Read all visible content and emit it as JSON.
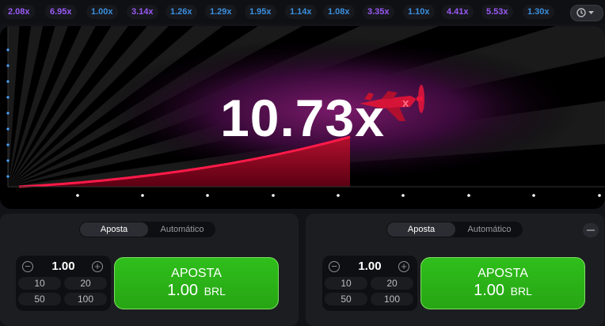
{
  "history": [
    {
      "value": "2.08x",
      "color": "#9b59f5"
    },
    {
      "value": "6.95x",
      "color": "#9b59f5"
    },
    {
      "value": "1.00x",
      "color": "#3a8fde"
    },
    {
      "value": "3.14x",
      "color": "#9b59f5"
    },
    {
      "value": "1.26x",
      "color": "#3a8fde"
    },
    {
      "value": "1.29x",
      "color": "#3a8fde"
    },
    {
      "value": "1.95x",
      "color": "#3a8fde"
    },
    {
      "value": "1.14x",
      "color": "#3a8fde"
    },
    {
      "value": "1.08x",
      "color": "#3a8fde"
    },
    {
      "value": "3.35x",
      "color": "#9b59f5"
    },
    {
      "value": "1.10x",
      "color": "#3a8fde"
    },
    {
      "value": "4.41x",
      "color": "#9b59f5"
    },
    {
      "value": "5.53x",
      "color": "#9b59f5"
    },
    {
      "value": "1.30x",
      "color": "#3a8fde"
    }
  ],
  "history_button": {
    "icons": [
      "history-icon",
      "chevron-down-icon"
    ]
  },
  "game": {
    "multiplier": "10.73x",
    "accent": "#e8153c"
  },
  "panels": [
    {
      "tabs": {
        "active": "Aposta",
        "inactive": "Automático"
      },
      "stake": "1.00",
      "quick": [
        "10",
        "20",
        "50",
        "100"
      ],
      "bet": {
        "label": "APOSTA",
        "amount": "1.00",
        "currency": "BRL"
      }
    },
    {
      "tabs": {
        "active": "Aposta",
        "inactive": "Automático"
      },
      "stake": "1.00",
      "quick": [
        "10",
        "20",
        "50",
        "100"
      ],
      "bet": {
        "label": "APOSTA",
        "amount": "1.00",
        "currency": "BRL"
      }
    }
  ]
}
